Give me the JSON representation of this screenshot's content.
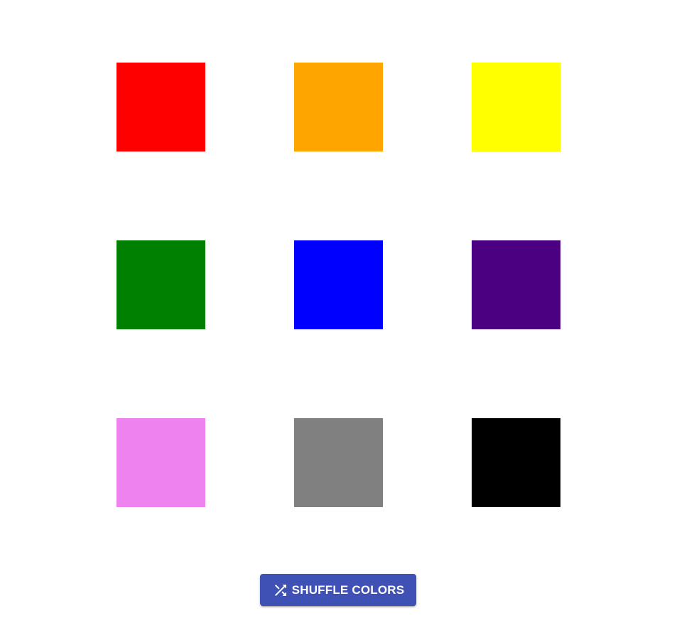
{
  "swatches": [
    {
      "name": "red",
      "color": "#ff0000"
    },
    {
      "name": "orange",
      "color": "#ffa500"
    },
    {
      "name": "yellow",
      "color": "#ffff00"
    },
    {
      "name": "green",
      "color": "#008000"
    },
    {
      "name": "blue",
      "color": "#0000ff"
    },
    {
      "name": "indigo",
      "color": "#4b0082"
    },
    {
      "name": "violet",
      "color": "#ee82ee"
    },
    {
      "name": "gray",
      "color": "#808080"
    },
    {
      "name": "black",
      "color": "#000000"
    }
  ],
  "shuffle_button": {
    "label": "SHUFFLE COLORS",
    "icon": "shuffle-icon",
    "color": "#3f51b5"
  }
}
